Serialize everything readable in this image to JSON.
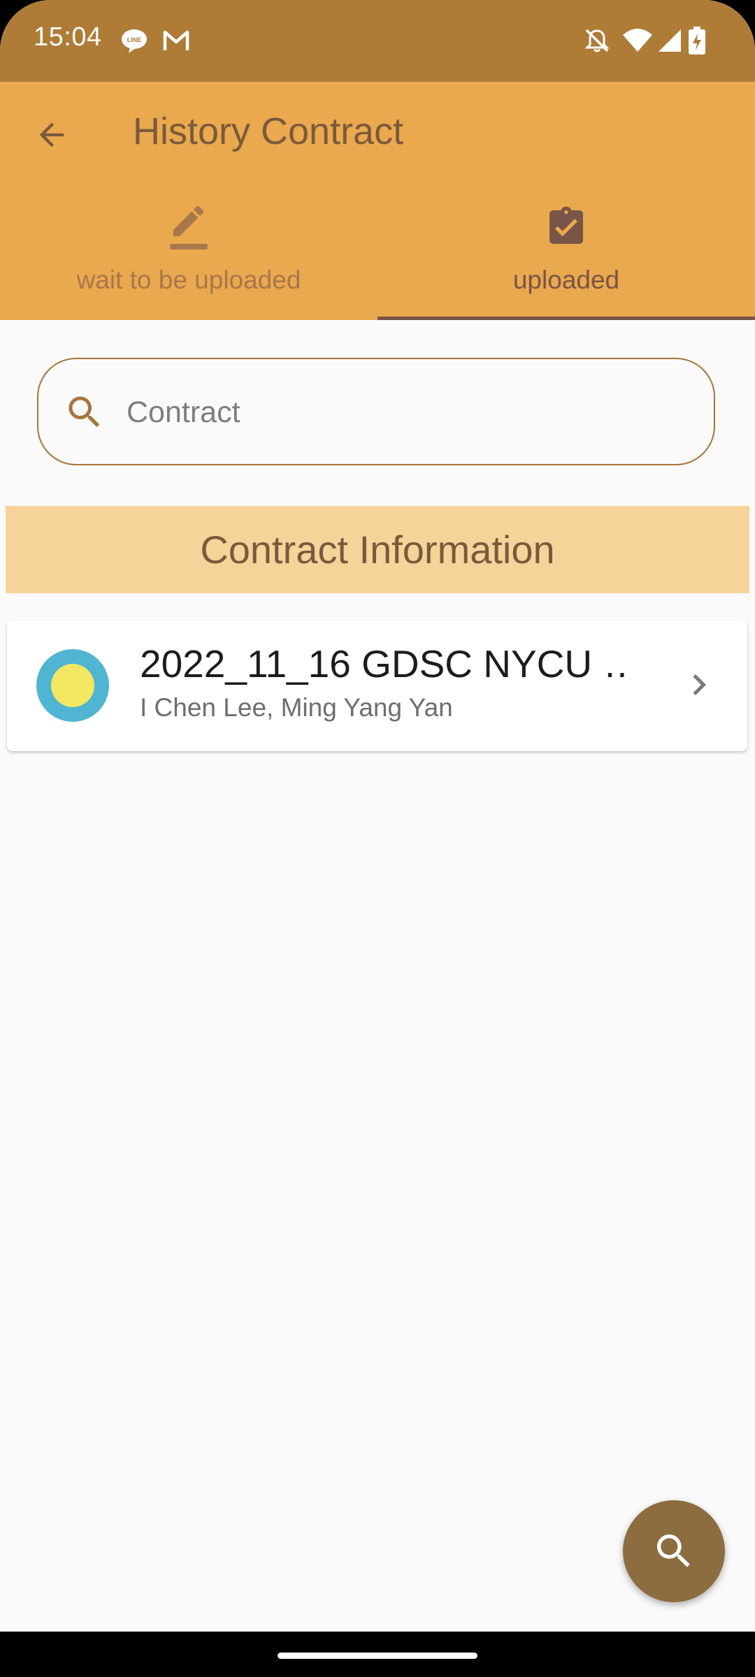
{
  "status_bar": {
    "time": "15:04",
    "notification_icons": [
      "line-icon",
      "gmail-icon"
    ],
    "system_icons": [
      "bell-off-icon",
      "wifi-icon",
      "signal-icon",
      "battery-charging-icon"
    ]
  },
  "app_bar": {
    "title": "History Contract",
    "background_color": "#EAA94E",
    "back_icon": "arrow-back-icon"
  },
  "tabs": [
    {
      "label": "wait to be uploaded",
      "icon": "edit-icon",
      "selected": false,
      "color": "#A8784C"
    },
    {
      "label": "uploaded",
      "icon": "assignment-turned-in-icon",
      "selected": true,
      "color": "#795548"
    }
  ],
  "search": {
    "placeholder": "Contract",
    "value": "",
    "icon": "search-icon",
    "border_color": "#A6763A"
  },
  "section_header": {
    "label": "Contract Information",
    "background_color": "#F6D399"
  },
  "contracts": [
    {
      "title": "2022_11_16 GDSC NYCU …",
      "subtitle": "I Chen Lee, Ming Yang Yan",
      "avatar_outer_color": "#4FB5D3",
      "avatar_inner_color": "#F3E762",
      "trailing_icon": "chevron-right-icon"
    }
  ],
  "fab": {
    "icon": "search-icon",
    "color": "#8C6D3F"
  }
}
